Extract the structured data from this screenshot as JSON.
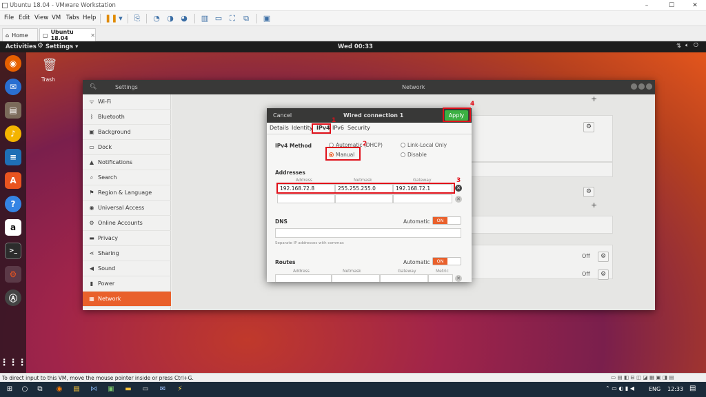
{
  "vm": {
    "title": "Ubuntu 18.04 - VMware Workstation",
    "menu": [
      "File",
      "Edit",
      "View",
      "VM",
      "Tabs",
      "Help"
    ],
    "tabs": [
      {
        "label": "Home"
      },
      {
        "label": "Ubuntu 18.04"
      }
    ],
    "status_text": "To direct input to this VM, move the mouse pointer inside or press Ctrl+G."
  },
  "ubuntu": {
    "activities": "Activities",
    "app_menu": "Settings ▾",
    "clock": "Wed 00:33",
    "trash_label": "Trash",
    "dock_icons": [
      "firefox-icon",
      "thunderbird-icon",
      "files-icon",
      "rhythmbox-icon",
      "writer-icon",
      "software-icon",
      "help-icon",
      "amazon-icon",
      "terminal-icon",
      "settings-icon",
      "updater-icon"
    ]
  },
  "settings": {
    "title": "Settings",
    "panel_title": "Network",
    "sidebar": [
      {
        "label": "Wi-Fi",
        "icon": "wifi-icon"
      },
      {
        "label": "Bluetooth",
        "icon": "bluetooth-icon"
      },
      {
        "label": "Background",
        "icon": "background-icon"
      },
      {
        "label": "Dock",
        "icon": "dock-icon"
      },
      {
        "label": "Notifications",
        "icon": "bell-icon"
      },
      {
        "label": "Search",
        "icon": "search-icon"
      },
      {
        "label": "Region & Language",
        "icon": "region-icon"
      },
      {
        "label": "Universal Access",
        "icon": "accessibility-icon"
      },
      {
        "label": "Online Accounts",
        "icon": "accounts-icon"
      },
      {
        "label": "Privacy",
        "icon": "privacy-icon"
      },
      {
        "label": "Sharing",
        "icon": "sharing-icon"
      },
      {
        "label": "Sound",
        "icon": "sound-icon"
      },
      {
        "label": "Power",
        "icon": "power-icon"
      },
      {
        "label": "Network",
        "icon": "network-icon",
        "selected": true
      }
    ],
    "off_label": "Off"
  },
  "dialog": {
    "cancel": "Cancel",
    "title": "Wired connection 1",
    "apply": "Apply",
    "tabs": [
      "Details",
      "Identity",
      "IPv4",
      "IPv6",
      "Security"
    ],
    "ipv4_method_label": "IPv4 Method",
    "methods": {
      "automatic": "Automatic (DHCP)",
      "manual": "Manual",
      "link_local": "Link-Local Only",
      "disable": "Disable"
    },
    "addresses_label": "Addresses",
    "address_cols": [
      "Address",
      "Netmask",
      "Gateway"
    ],
    "address_row": {
      "address": "192.168.72.8",
      "netmask": "255.255.255.0",
      "gateway": "192.168.72.1"
    },
    "dns_label": "DNS",
    "automatic_label": "Automatic",
    "on_label": "ON",
    "dns_hint": "Separate IP addresses with commas",
    "routes_label": "Routes",
    "route_cols": [
      "Address",
      "Netmask",
      "Gateway",
      "Metric"
    ]
  },
  "annotations": [
    "1",
    "2",
    "3",
    "4"
  ],
  "taskbar": {
    "lang": "ENG",
    "time": "12:33"
  },
  "colors": {
    "accent": "#e9602b",
    "apply_green": "#3cb043",
    "annotation_red": "#e0101a"
  }
}
